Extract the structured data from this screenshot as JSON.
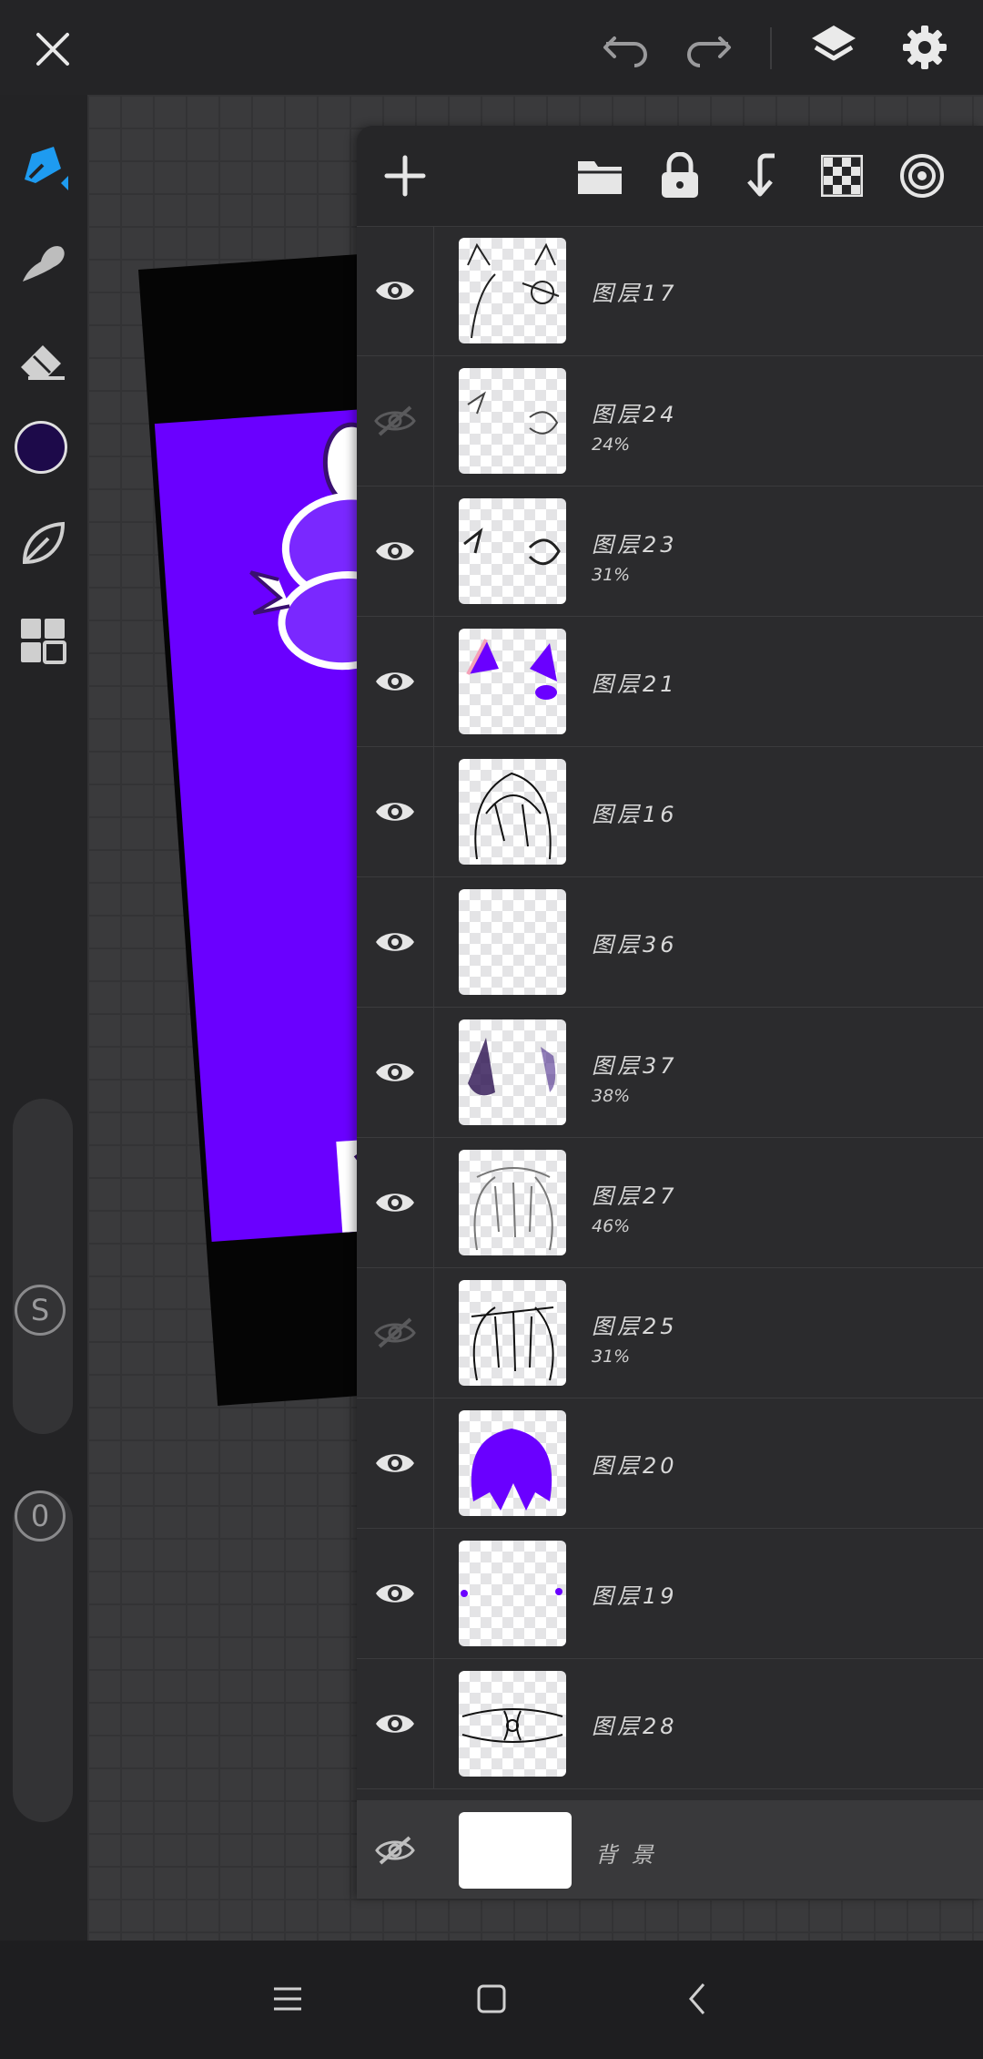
{
  "layers_panel": {
    "layers": [
      {
        "name": "图层17",
        "opacity": "",
        "visible": true,
        "thumb": "cat-ears-sketch"
      },
      {
        "name": "图层24",
        "opacity": "24%",
        "visible": false,
        "thumb": "ears-sketch-faint"
      },
      {
        "name": "图层23",
        "opacity": "31%",
        "visible": true,
        "thumb": "ears-sketch"
      },
      {
        "name": "图层21",
        "opacity": "",
        "visible": true,
        "thumb": "purple-ears"
      },
      {
        "name": "图层16",
        "opacity": "",
        "visible": true,
        "thumb": "hair-lineart"
      },
      {
        "name": "图层36",
        "opacity": "",
        "visible": true,
        "thumb": "empty"
      },
      {
        "name": "图层37",
        "opacity": "38%",
        "visible": true,
        "thumb": "shading"
      },
      {
        "name": "图层27",
        "opacity": "46%",
        "visible": true,
        "thumb": "hair-sketch-faint"
      },
      {
        "name": "图层25",
        "opacity": "31%",
        "visible": false,
        "thumb": "hair-sketch"
      },
      {
        "name": "图层20",
        "opacity": "",
        "visible": true,
        "thumb": "purple-hair"
      },
      {
        "name": "图层19",
        "opacity": "",
        "visible": true,
        "thumb": "dots"
      },
      {
        "name": "图层28",
        "opacity": "",
        "visible": true,
        "thumb": "ribbon"
      }
    ],
    "background_layer": {
      "name": "背 景",
      "visible": false
    }
  },
  "left_tools": {
    "current_color": "#1d0a4a",
    "brush_size_label": "S",
    "opacity_label": "0"
  },
  "colors": {
    "accent": "#1e9bf0",
    "art_purple": "#6a00ff"
  }
}
